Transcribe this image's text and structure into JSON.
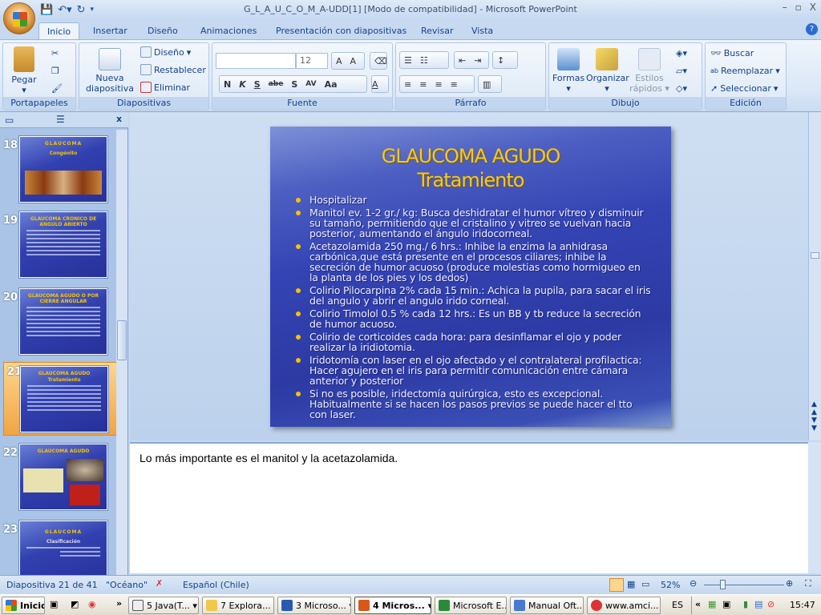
{
  "window": {
    "title": "G_L_A_U_C_O_M_A-UDD[1] [Modo de compatibilidad] - Microsoft PowerPoint",
    "controls": [
      "–",
      "▫",
      "X"
    ]
  },
  "ribbon_tabs": [
    "Inicio",
    "Insertar",
    "Diseño",
    "Animaciones",
    "Presentación con diapositivas",
    "Revisar",
    "Vista"
  ],
  "groups": {
    "portapapeles": {
      "label": "Portapapeles",
      "paste": "Pegar"
    },
    "diapositivas": {
      "label": "Diapositivas",
      "new_slide": "Nueva diapositiva",
      "layout": "Diseño",
      "reset": "Restablecer",
      "delete": "Eliminar"
    },
    "fuente": {
      "label": "Fuente",
      "font_name": "",
      "font_size": "12",
      "buttons": [
        "N",
        "K",
        "S",
        "abe",
        "S",
        "AV",
        "Aa",
        "A"
      ]
    },
    "parrafo": {
      "label": "Párrafo"
    },
    "dibujo": {
      "label": "Dibujo",
      "shapes": "Formas",
      "arrange": "Organizar",
      "quick_styles": "Estilos rápidos"
    },
    "edicion": {
      "label": "Edición",
      "find": "Buscar",
      "replace": "Reemplazar",
      "select": "Seleccionar"
    }
  },
  "thumbnails": [
    {
      "num": "18",
      "title": "GLAUCOMA",
      "subtitle": "Congénito"
    },
    {
      "num": "19",
      "title": "GLAUCOMA CRONICO DE ANGULO ABIERTO",
      "subtitle": ""
    },
    {
      "num": "20",
      "title": "GLAUCOMA AGUDO O POR CIERRE ANGULAR",
      "subtitle": ""
    },
    {
      "num": "21",
      "title": "GLAUCOMA AGUDO",
      "subtitle": "Tratamiento"
    },
    {
      "num": "22",
      "title": "GLAUCOMA AGUDO",
      "subtitle": ""
    },
    {
      "num": "23",
      "title": "GLAUCOMA",
      "subtitle": "Clasificación"
    }
  ],
  "slide": {
    "title": "GLAUCOMA AGUDO",
    "subtitle": "Tratamiento",
    "bullets": [
      "Hospitalizar",
      "Manitol ev. 1-2 gr./ kg: Busca deshidratar el humor vítreo y disminuir su tamaño, permitiendo que el cristalino y vitreo se vuelvan hacia posterior, aumentando el ángulo iridocorneal.",
      "Acetazolamida 250 mg./ 6 hrs.: Inhibe la enzima la anhidrasa carbónica,que está presente en el procesos ciliares; inhibe la secreción de humor acuoso (produce molestias como hormigueo en la planta de los pies y los dedos)",
      "Colirio Pilocarpina 2% cada 15 min.: Achica la pupila, para sacar el iris del angulo y abrir el angulo irido corneal.",
      "Colirio Timolol 0.5 % cada 12 hrs.: Es un BB y tb reduce la secreción de humor acuoso.",
      "Colirio de corticoides cada  hora: para desinflamar el ojo y poder realizar la iridiotomia.",
      "Iridotomía con laser en el ojo afectado y el contralateral profilactica: Hacer agujero en el iris para permitir comunicación entre cámara anterior y posterior",
      "Si no es posible, iridectomía quirúrgica, esto es excepcional. Habitualmente si se hacen los pasos previos se puede hacer el tto con laser."
    ]
  },
  "notes": "Lo más importante es el manitol y la acetazolamida.",
  "status": {
    "slide": "Diapositiva 21 de 41",
    "theme": "\"Océano\"",
    "language": "Español (Chile)",
    "zoom": "52%",
    "zoom_level": 52
  },
  "taskbar": {
    "start": "Inicio",
    "items": [
      "5 Java(T...",
      "7 Explora...",
      "3 Microso...",
      "4 Micros...",
      "Microsoft E...",
      "Manual Oft...",
      "www.amci..."
    ],
    "lang": "ES",
    "clock": "15:47"
  }
}
